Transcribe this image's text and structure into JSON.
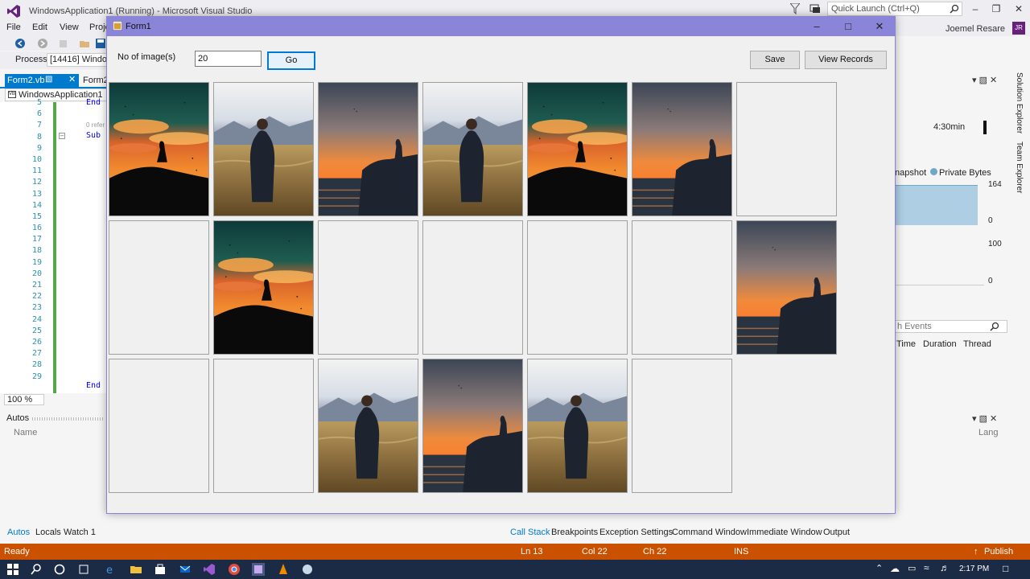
{
  "vs": {
    "title": "WindowsApplication1 (Running) - Microsoft Visual Studio",
    "quick_launch_placeholder": "Quick Launch (Ctrl+Q)",
    "user": "Joemel Resare",
    "user_initials": "JR",
    "menu": [
      "File",
      "Edit",
      "View",
      "Proje"
    ],
    "process_label": "Process:",
    "process_value": "[14416] Window",
    "doc_tabs": [
      "Form2.vb",
      "Form2."
    ],
    "project_nav": "WindowsApplication1",
    "line_numbers": [
      "5",
      "6",
      "7",
      "8",
      "9",
      "10",
      "11",
      "12",
      "13",
      "14",
      "15",
      "16",
      "17",
      "18",
      "19",
      "20",
      "21",
      "22",
      "23",
      "24",
      "25",
      "26",
      "27",
      "28",
      "29"
    ],
    "code": {
      "end1": "End",
      "refs": "0 refer",
      "sub": "Sub",
      "end2": "End"
    },
    "zoom": "100 %",
    "autos_title": "Autos",
    "autos_col_name": "Name",
    "autos_col_lang": "Lang",
    "bottom_tabs_left": [
      "Autos",
      "Locals",
      "Watch 1"
    ],
    "bottom_tabs_right": [
      "Call Stack",
      "Breakpoints",
      "Exception Settings",
      "Command Window",
      "Immediate Window",
      "Output"
    ],
    "diag": {
      "timer": "4:30min",
      "snapshot": "napshot",
      "private_bytes": "Private Bytes",
      "mem_max": "164",
      "mem_min": "0",
      "cpu_max": "100",
      "cpu_min": "0",
      "events_search": "h Events",
      "event_cols": [
        "Time",
        "Duration",
        "Thread"
      ]
    },
    "side_tabs": [
      "Solution Explorer",
      "Team Explorer"
    ],
    "status": {
      "ready": "Ready",
      "line": "Ln 13",
      "col": "Col 22",
      "ch": "Ch 22",
      "ins": "INS",
      "publish": "Publish"
    },
    "clock": "2:17 PM"
  },
  "form": {
    "title": "Form1",
    "count_label": "No of image(s)",
    "count_value": "20",
    "go_label": "Go",
    "save_label": "Save",
    "view_records_label": "View Records"
  },
  "gallery": {
    "columns": 7,
    "tiles": [
      "sunset-cliff",
      "grass-field",
      "orange-cliff",
      "grass-field",
      "sunset-cliff",
      "orange-cliff",
      "empty",
      "empty",
      "sunset-cliff",
      "empty",
      "empty",
      "empty",
      "empty",
      "orange-cliff",
      "empty",
      "empty",
      "grass-field",
      "orange-cliff",
      "grass-field",
      "empty"
    ]
  },
  "colors": {
    "vs_accent": "#007acc",
    "status_bar": "#ca5100",
    "form_titlebar": "#8b85d9"
  }
}
